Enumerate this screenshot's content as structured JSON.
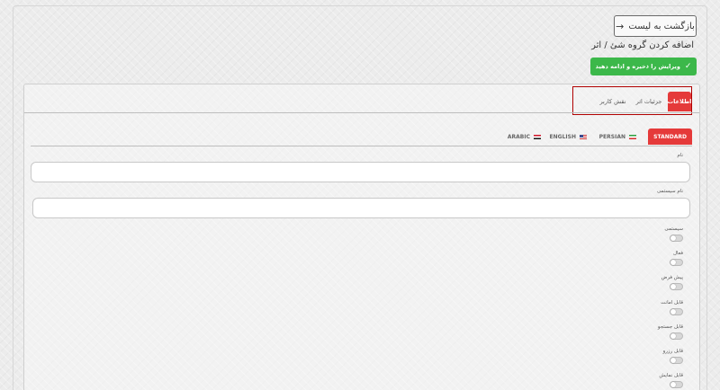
{
  "header": {
    "back_label": "بازگشت به لیست",
    "back_arrow": "→",
    "title": "اضافه کردن گروه شئ / اثر",
    "save_label": "ویرایش را ذخیره و ادامه دهید",
    "save_icon": "✓"
  },
  "tabs": [
    {
      "label": "اطلاعات",
      "active": true
    },
    {
      "label": "جزئیات اثر",
      "active": false
    },
    {
      "label": "نقش کاربر",
      "active": false
    }
  ],
  "languages": [
    {
      "label": "STANDARD",
      "active": true,
      "flag": ""
    },
    {
      "label": "PERSIAN",
      "active": false,
      "flag": "iran-flag-icon"
    },
    {
      "label": "ENGLISH",
      "active": false,
      "flag": "us-flag-icon"
    },
    {
      "label": "ARABIC",
      "active": false,
      "flag": "egypt-flag-icon"
    }
  ],
  "fields": [
    {
      "label": "نام",
      "value": ""
    },
    {
      "label": "نام سیستمی",
      "value": ""
    }
  ],
  "toggles": [
    {
      "label": "سیستمی",
      "on": false
    },
    {
      "label": "فعال",
      "on": false
    },
    {
      "label": "پیش فرض",
      "on": false
    },
    {
      "label": "قابل امانت",
      "on": false
    },
    {
      "label": "قابل جستجو",
      "on": false
    },
    {
      "label": "قابل رزرو",
      "on": false
    },
    {
      "label": "قابل نمایش",
      "on": false
    }
  ],
  "colors": {
    "accent_red": "#e53a3a",
    "save_green": "#3cb84a",
    "highlight_border": "#b00000"
  }
}
